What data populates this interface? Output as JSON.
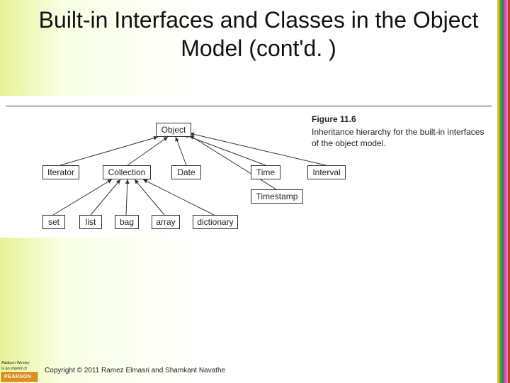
{
  "title": "Built-in Interfaces and Classes in the Object Model (cont'd. )",
  "figure": {
    "number": "Figure 11.6",
    "caption": "Inheritance hierarchy for the built-in interfaces of the object model."
  },
  "nodes": {
    "object": "Object",
    "iterator": "Iterator",
    "collection": "Collection",
    "date": "Date",
    "time": "Time",
    "interval": "Interval",
    "timestamp": "Timestamp",
    "set": "set",
    "list": "list",
    "bag": "bag",
    "array": "array",
    "dictionary": "dictionary"
  },
  "chart_data": {
    "type": "hierarchy",
    "title": "Inheritance hierarchy for the built-in interfaces of the object model",
    "root": "Object",
    "edges": [
      [
        "Iterator",
        "Object"
      ],
      [
        "Collection",
        "Object"
      ],
      [
        "Date",
        "Object"
      ],
      [
        "Time",
        "Object"
      ],
      [
        "Interval",
        "Object"
      ],
      [
        "Timestamp",
        "Object"
      ],
      [
        "set",
        "Collection"
      ],
      [
        "list",
        "Collection"
      ],
      [
        "bag",
        "Collection"
      ],
      [
        "array",
        "Collection"
      ],
      [
        "dictionary",
        "Collection"
      ]
    ]
  },
  "footer": {
    "imprint_line1": "Addison-Wesley",
    "imprint_line2": "is an imprint of",
    "publisher": "PEARSON",
    "copyright": "Copyright © 2011 Ramez Elmasri and Shamkant Navathe"
  },
  "colors": {
    "strip": [
      "#d7c838",
      "#5da03b",
      "#2f7f6a",
      "#c75194",
      "#e075c5",
      "#bb3d32"
    ]
  }
}
